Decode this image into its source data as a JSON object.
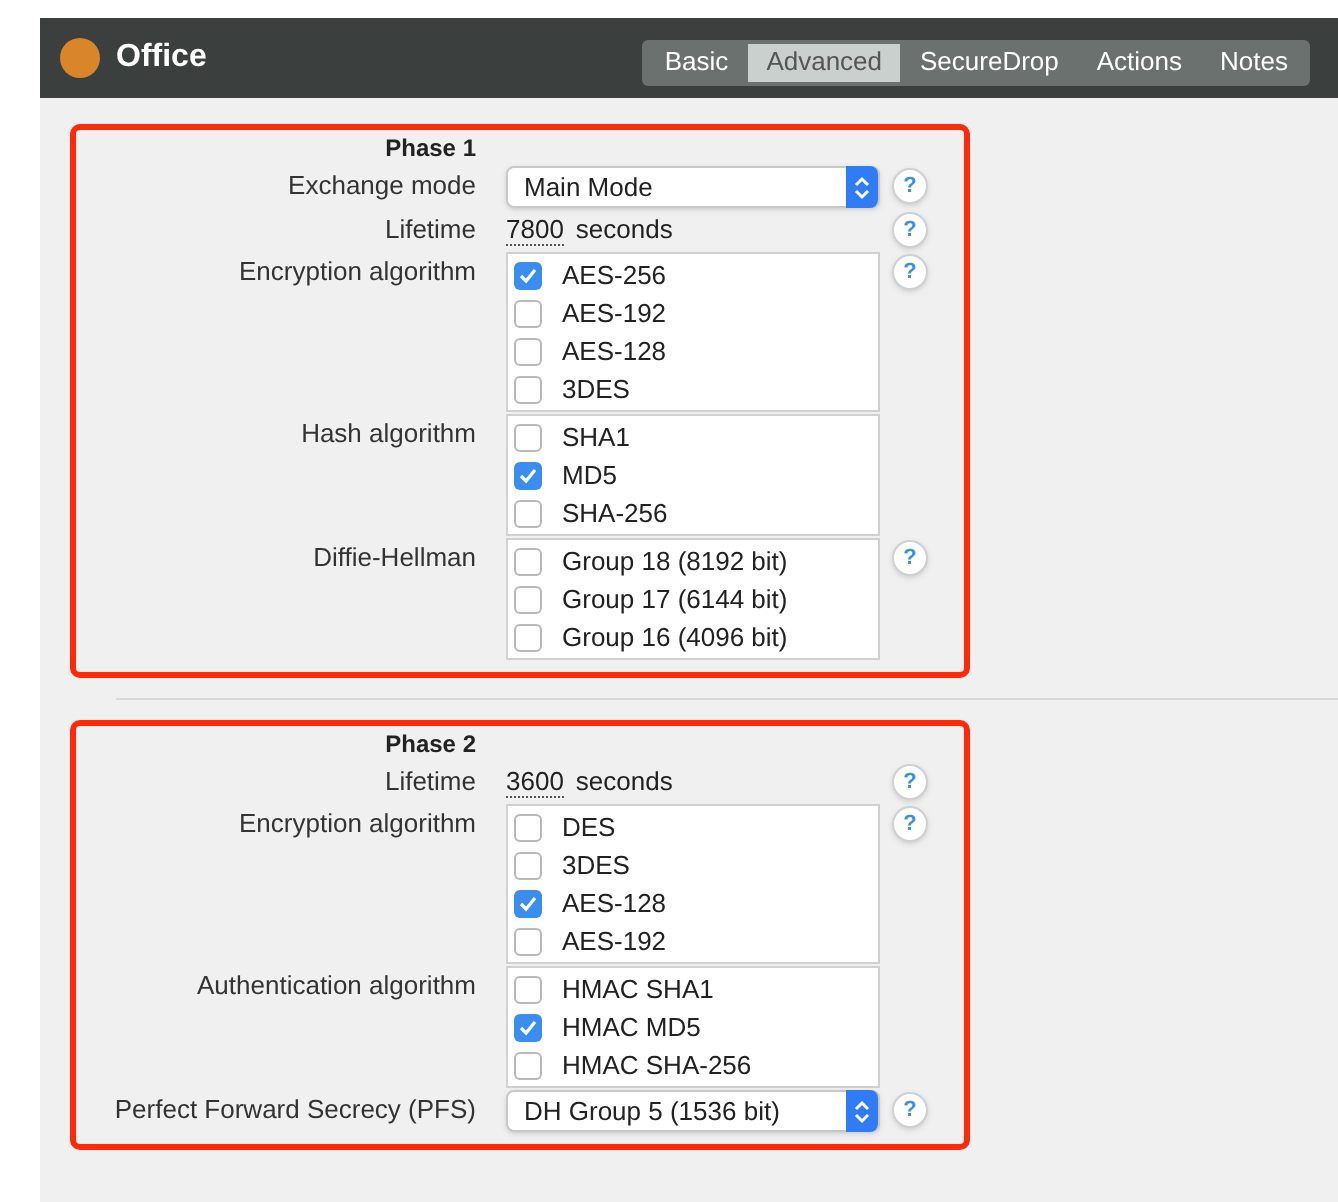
{
  "header": {
    "title": "Office"
  },
  "tabs": [
    {
      "label": "Basic",
      "selected": false
    },
    {
      "label": "Advanced",
      "selected": true
    },
    {
      "label": "SecureDrop",
      "selected": false
    },
    {
      "label": "Actions",
      "selected": false
    },
    {
      "label": "Notes",
      "selected": false
    }
  ],
  "sections": [
    {
      "title": "Phase 1",
      "fields": [
        {
          "kind": "select",
          "label": "Exchange mode",
          "value": "Main Mode",
          "help": "?"
        },
        {
          "kind": "lifetime",
          "label": "Lifetime",
          "value": "7800",
          "unit": "seconds",
          "help": "?"
        },
        {
          "kind": "checklist",
          "label": "Encryption algorithm",
          "help": "?",
          "options": [
            {
              "label": "AES-256",
              "checked": true
            },
            {
              "label": "AES-192",
              "checked": false
            },
            {
              "label": "AES-128",
              "checked": false
            },
            {
              "label": "3DES",
              "checked": false
            }
          ]
        },
        {
          "kind": "checklist",
          "label": "Hash algorithm",
          "options": [
            {
              "label": "SHA1",
              "checked": false
            },
            {
              "label": "MD5",
              "checked": true
            },
            {
              "label": "SHA-256",
              "checked": false
            }
          ]
        },
        {
          "kind": "checklist",
          "label": "Diffie-Hellman",
          "help": "?",
          "options": [
            {
              "label": "Group 18 (8192 bit)",
              "checked": false
            },
            {
              "label": "Group 17 (6144 bit)",
              "checked": false
            },
            {
              "label": "Group 16 (4096 bit)",
              "checked": false
            }
          ]
        }
      ]
    },
    {
      "title": "Phase 2",
      "fields": [
        {
          "kind": "lifetime",
          "label": "Lifetime",
          "value": "3600",
          "unit": "seconds",
          "help": "?"
        },
        {
          "kind": "checklist",
          "label": "Encryption algorithm",
          "help": "?",
          "options": [
            {
              "label": "DES",
              "checked": false
            },
            {
              "label": "3DES",
              "checked": false
            },
            {
              "label": "AES-128",
              "checked": true
            },
            {
              "label": "AES-192",
              "checked": false
            }
          ]
        },
        {
          "kind": "checklist",
          "label": "Authentication algorithm",
          "options": [
            {
              "label": "HMAC SHA1",
              "checked": false
            },
            {
              "label": "HMAC MD5",
              "checked": true
            },
            {
              "label": "HMAC SHA-256",
              "checked": false
            }
          ]
        },
        {
          "kind": "select",
          "label": "Perfect Forward Secrecy (PFS)",
          "value": "DH Group 5 (1536 bit)",
          "help": "?"
        }
      ]
    }
  ]
}
